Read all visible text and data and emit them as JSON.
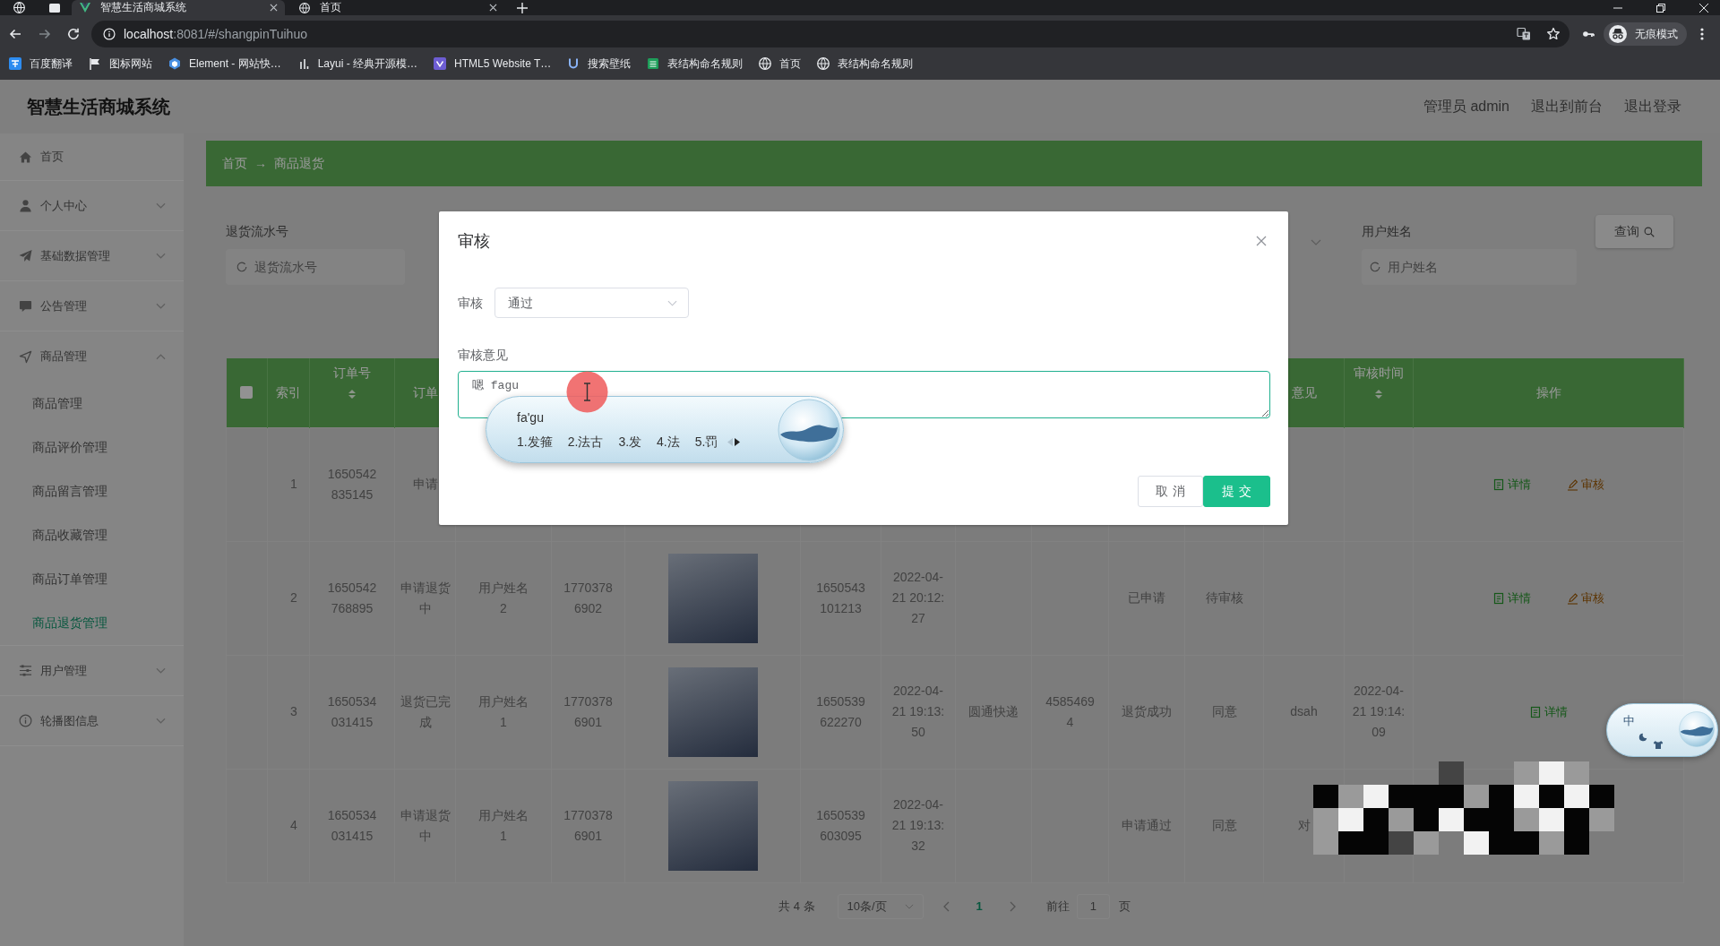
{
  "browser": {
    "tabs": [
      {
        "title": "智慧生活商城系统",
        "selected": true
      },
      {
        "title": "首页",
        "selected": false
      }
    ],
    "url": {
      "host": "localhost",
      "rest": ":8081/#/shangpinTuihuo"
    },
    "profile": "无痕模式",
    "bookmarks": [
      "百度翻译",
      "图标网站",
      "Element - 网站快…",
      "Layui - 经典开源模…",
      "HTML5 Website T…",
      "搜索壁纸",
      "表结构命名规则",
      "首页",
      "表结构命名规则"
    ]
  },
  "header": {
    "title": "智慧生活商城系统",
    "links": [
      "管理员 admin",
      "退出到前台",
      "退出登录"
    ]
  },
  "sidebar": {
    "items": [
      {
        "label": "首页",
        "kind": "link"
      },
      {
        "label": "个人中心",
        "kind": "menu",
        "expanded": false
      },
      {
        "label": "基础数据管理",
        "kind": "menu",
        "expanded": false
      },
      {
        "label": "公告管理",
        "kind": "menu",
        "expanded": false
      },
      {
        "label": "商品管理",
        "kind": "menu",
        "expanded": true,
        "children": [
          {
            "label": "商品管理",
            "selected": false
          },
          {
            "label": "商品评价管理",
            "selected": false
          },
          {
            "label": "商品留言管理",
            "selected": false
          },
          {
            "label": "商品收藏管理",
            "selected": false
          },
          {
            "label": "商品订单管理",
            "selected": false
          },
          {
            "label": "商品退货管理",
            "selected": true
          }
        ]
      },
      {
        "label": "用户管理",
        "kind": "menu",
        "expanded": false
      },
      {
        "label": "轮播图信息",
        "kind": "menu",
        "expanded": false
      }
    ]
  },
  "breadcrumb": {
    "items": [
      "首页",
      "商品退货"
    ],
    "separator": "→"
  },
  "search": {
    "fields": [
      {
        "label": "退货流水号",
        "placeholder": "退货流水号"
      },
      {
        "label": "用户姓名",
        "placeholder": "用户姓名"
      }
    ],
    "button": "查询"
  },
  "table": {
    "header_checkbox": {
      "checked": false
    },
    "columns": [
      {
        "label": "索引",
        "sortable": false
      },
      {
        "label": "订单号",
        "sortable": true
      },
      {
        "label": "订单",
        "sortable": false
      },
      null,
      null,
      null,
      null,
      null,
      null,
      null,
      null,
      null,
      {
        "label": "意见",
        "sortable": false
      },
      {
        "label": "审核时间",
        "sortable": true
      },
      {
        "label": "操作",
        "sortable": false
      }
    ],
    "rows": [
      {
        "cells": [
          "1",
          "1650542835145",
          "申请",
          null,
          null,
          null,
          null,
          null,
          null,
          null,
          null,
          null,
          null,
          null,
          {
            "kind": "actions",
            "items": [
              {
                "label": "详情",
                "kind": "detail"
              },
              {
                "label": "审核",
                "kind": "review"
              }
            ]
          }
        ]
      },
      {
        "cells": [
          "2",
          "1650542768895",
          "申请退货中",
          "用户姓名2",
          "17703786902",
          {
            "kind": "photo"
          },
          "1650543101213",
          "2022-04-21 20:12:27",
          null,
          null,
          "已申请",
          "待审核",
          null,
          null,
          {
            "kind": "actions",
            "items": [
              {
                "label": "详情",
                "kind": "detail"
              },
              {
                "label": "审核",
                "kind": "review"
              }
            ]
          }
        ]
      },
      {
        "cells": [
          "3",
          "1650534031415",
          "退货已完成",
          "用户姓名1",
          "17703786901",
          {
            "kind": "photo"
          },
          "1650539622270",
          "2022-04-21 19:13:50",
          "圆通快递",
          "45854694",
          "退货成功",
          "同意",
          "dsah",
          "2022-04-21 19:14:09",
          {
            "kind": "actions",
            "items": [
              {
                "label": "详情",
                "kind": "detail"
              }
            ]
          }
        ]
      },
      {
        "cells": [
          "4",
          "1650534031415",
          "申请退货中",
          "用户姓名1",
          "17703786901",
          {
            "kind": "photo"
          },
          "1650539603095",
          "2022-04-21 19:13:32",
          null,
          null,
          "申请通过",
          "同意",
          "对",
          null,
          null
        ]
      }
    ]
  },
  "pagination": {
    "total": "共 4 条",
    "page_size": "10条/页",
    "pages": [
      {
        "label": "1",
        "selected": true
      }
    ],
    "jump_label": "前往",
    "jump_value": "1",
    "jump_suffix": "页"
  },
  "dialog": {
    "modal": true,
    "title": "审核",
    "fields": [
      {
        "kind": "select",
        "label": "审核",
        "value": "通过"
      },
      {
        "kind": "textarea",
        "label": "审核意见",
        "value": "嗯 fagu",
        "focused": true
      }
    ],
    "buttons": [
      {
        "label": "取消",
        "kind": "default"
      },
      {
        "label": "提交",
        "kind": "primary"
      }
    ]
  },
  "ime": {
    "composition": "fa'gu",
    "candidates": [
      "1.发箍",
      "2.法古",
      "3.发",
      "4.法",
      "5.罚"
    ]
  },
  "ime_status": {
    "mode": "中"
  },
  "redaction": {
    "kind": "mosaic"
  }
}
